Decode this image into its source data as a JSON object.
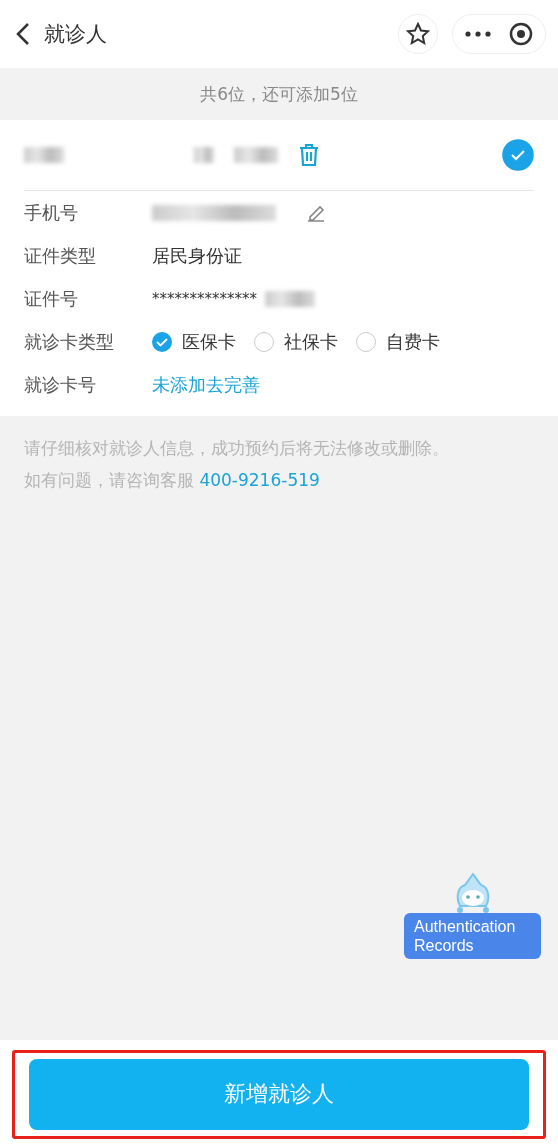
{
  "header": {
    "title": "就诊人"
  },
  "summary": "共6位，还可添加5位",
  "patient": {
    "selected": true
  },
  "fields": [
    {
      "kind": "masked",
      "label": "手机号"
    },
    {
      "kind": "text",
      "label": "证件类型",
      "value": "居民身份证"
    },
    {
      "kind": "masked",
      "label": "证件号",
      "value": "**************"
    },
    {
      "kind": "radio",
      "label": "就诊卡类型",
      "options": [
        {
          "label": "医保卡",
          "selected": true
        },
        {
          "label": "社保卡",
          "selected": false
        },
        {
          "label": "自费卡",
          "selected": false
        }
      ]
    },
    {
      "kind": "link",
      "label": "就诊卡号",
      "value": "未添加去完善"
    }
  ],
  "notice": {
    "text": "请仔细核对就诊人信息，成功预约后将无法修改或删除。",
    "prefix": "如有问题，请咨询客服",
    "phone": "400-9216-519"
  },
  "floating_badge": {
    "label": "Authentication Records"
  },
  "add_button": {
    "label": "新增就诊人",
    "highlighted": true
  }
}
